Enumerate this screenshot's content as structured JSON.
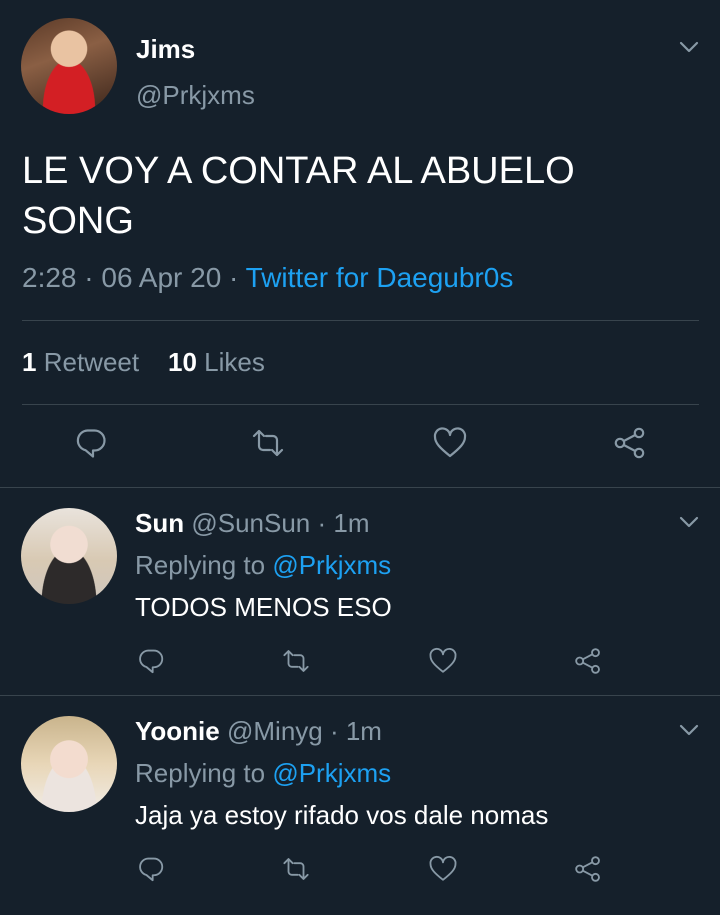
{
  "main_tweet": {
    "name": "Jims",
    "handle": "@Prkjxms",
    "text": "LE VOY A CONTAR AL ABUELO SONG",
    "time": "2:28",
    "date": "06 Apr 20",
    "dot": "·",
    "source": "Twitter for Daegubr0s",
    "retweet_count": "1",
    "retweet_label": "Retweet",
    "like_count": "10",
    "like_label": "Likes"
  },
  "replies": [
    {
      "name": "Sun",
      "handle": "@SunSun",
      "time": "· 1m",
      "replying_prefix": "Replying to",
      "replying_to": "@Prkjxms",
      "text": "TODOS MENOS ESO"
    },
    {
      "name": "Yoonie",
      "handle": "@Minyg",
      "time": "· 1m",
      "replying_prefix": "Replying to",
      "replying_to": "@Prkjxms",
      "text": "Jaja ya estoy rifado vos dale nomas"
    }
  ],
  "icons": [
    "chevron-down-icon",
    "reply-icon",
    "retweet-icon",
    "like-icon",
    "share-icon"
  ],
  "colors": {
    "background": "#15202b",
    "muted": "#8899a6",
    "accent": "#1da1f2",
    "divider": "#38444d"
  }
}
